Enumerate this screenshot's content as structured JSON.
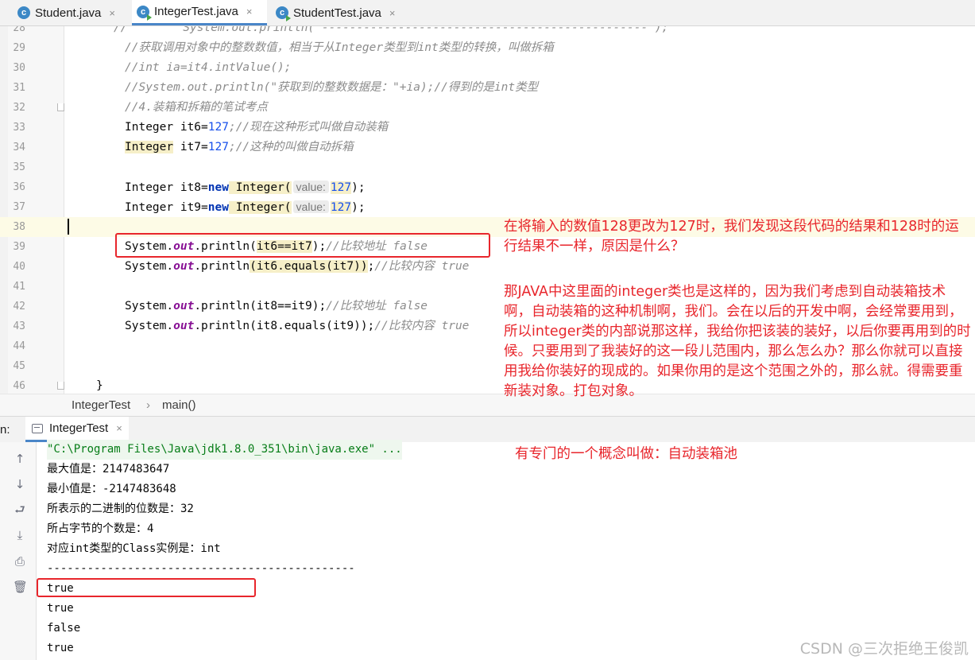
{
  "tabs": [
    {
      "label": "Student.java",
      "icon": "java-class-icon"
    },
    {
      "label": "IntegerTest.java",
      "icon": "java-class-runnable-icon",
      "active": true
    },
    {
      "label": "StudentTest.java",
      "icon": "java-class-runnable-icon"
    }
  ],
  "tab_close_glyph": "×",
  "editor": {
    "lines": [
      {
        "n": "28",
        "t": "//        System.out.println(\"-----------------------------------------------\");"
      },
      {
        "n": "29",
        "t": "//获取调用对象中的整数数值，相当于从Integer类型到int类型的转换，叫做拆箱"
      },
      {
        "n": "30",
        "t": "//int ia=it4.intValue();"
      },
      {
        "n": "31",
        "t": "//System.out.println(\"获取到的整数数据是：\"+ia);//得到的是int类型"
      },
      {
        "n": "32",
        "t": "//4.装箱和拆箱的笔试考点"
      },
      {
        "n": "33",
        "a": "Integer it6=",
        "b": "127",
        "c": ";//现在这种形式叫做自动装箱"
      },
      {
        "n": "34",
        "a": "Integer",
        "b": " it7=",
        "c": "127",
        "d": ";//这种的叫做自动拆箱"
      },
      {
        "n": "35"
      },
      {
        "n": "36",
        "a": "Integer it8=",
        "kw": "new",
        "cls": " Integer(",
        "hint": "value:",
        "num": "127",
        "end": ");"
      },
      {
        "n": "37",
        "a": "Integer it9=",
        "kw": "new",
        "cls": " Integer(",
        "hint": "value:",
        "num": "127",
        "end": ");"
      },
      {
        "n": "38"
      },
      {
        "n": "39",
        "a": "System.",
        "fld": "out",
        "b": ".println(",
        "c": "it6==it7",
        "d": ");",
        "cmt": "//比较地址 false"
      },
      {
        "n": "40",
        "a": "System.",
        "fld": "out",
        "b": ".println",
        "c": "(it6.equals(it7))",
        "d": ";",
        "cmt": "//比较内容 true"
      },
      {
        "n": "41"
      },
      {
        "n": "42",
        "a": "System.",
        "fld": "out",
        "b": ".println(it8==it9);",
        "cmt": "//比较地址 false"
      },
      {
        "n": "43",
        "a": "System.",
        "fld": "out",
        "b": ".println(it8.equals(it9));",
        "cmt": "//比较内容 true"
      },
      {
        "n": "44"
      },
      {
        "n": "45"
      },
      {
        "n": "46",
        "t": "}"
      }
    ]
  },
  "breadcrumb": {
    "class_name": "IntegerTest",
    "sep": "›",
    "method": "main()"
  },
  "run": {
    "label_prefix": "n:",
    "tab_label": "IntegerTest",
    "tab_close": "×",
    "command": "\"C:\\Program Files\\Java\\jdk1.8.0_351\\bin\\java.exe\" ...",
    "output": [
      "最大值是：2147483647",
      "最小值是：-2147483648",
      "所表示的二进制的位数是：32",
      "所占字节的个数是：4",
      "对应int类型的Class实例是：int",
      "----------------------------------------------",
      "true",
      "true",
      "false",
      "true"
    ]
  },
  "annotations": {
    "note1": "在将输入的数值128更改为127时，我们发现这段代码的结果和128时的运行结果不一样，原因是什么？",
    "note2": "那JAVA中这里面的integer类也是这样的，因为我们考虑到自动装箱技术啊，自动装箱的这种机制啊，我们。会在以后的开发中啊，会经常要用到，所以integer类的内部说那这样，我给你把该装的装好，以后你要再用到的时候。只要用到了我装好的这一段儿范围内，那么怎么办？那么你就可以直接用我给你装好的现成的。如果你用的是这个范围之外的，那么就。得需要重新装对象。打包对象。",
    "note3": "有专门的一个概念叫做：自动装箱池"
  },
  "watermark": "CSDN @三次拒绝王俊凯",
  "colors": {
    "annotation_red": "#e8262c",
    "keyword": "#0033b3",
    "number": "#1750eb",
    "comment": "#8c8c8c",
    "field": "#871094",
    "tab_accent": "#4a86c8"
  }
}
